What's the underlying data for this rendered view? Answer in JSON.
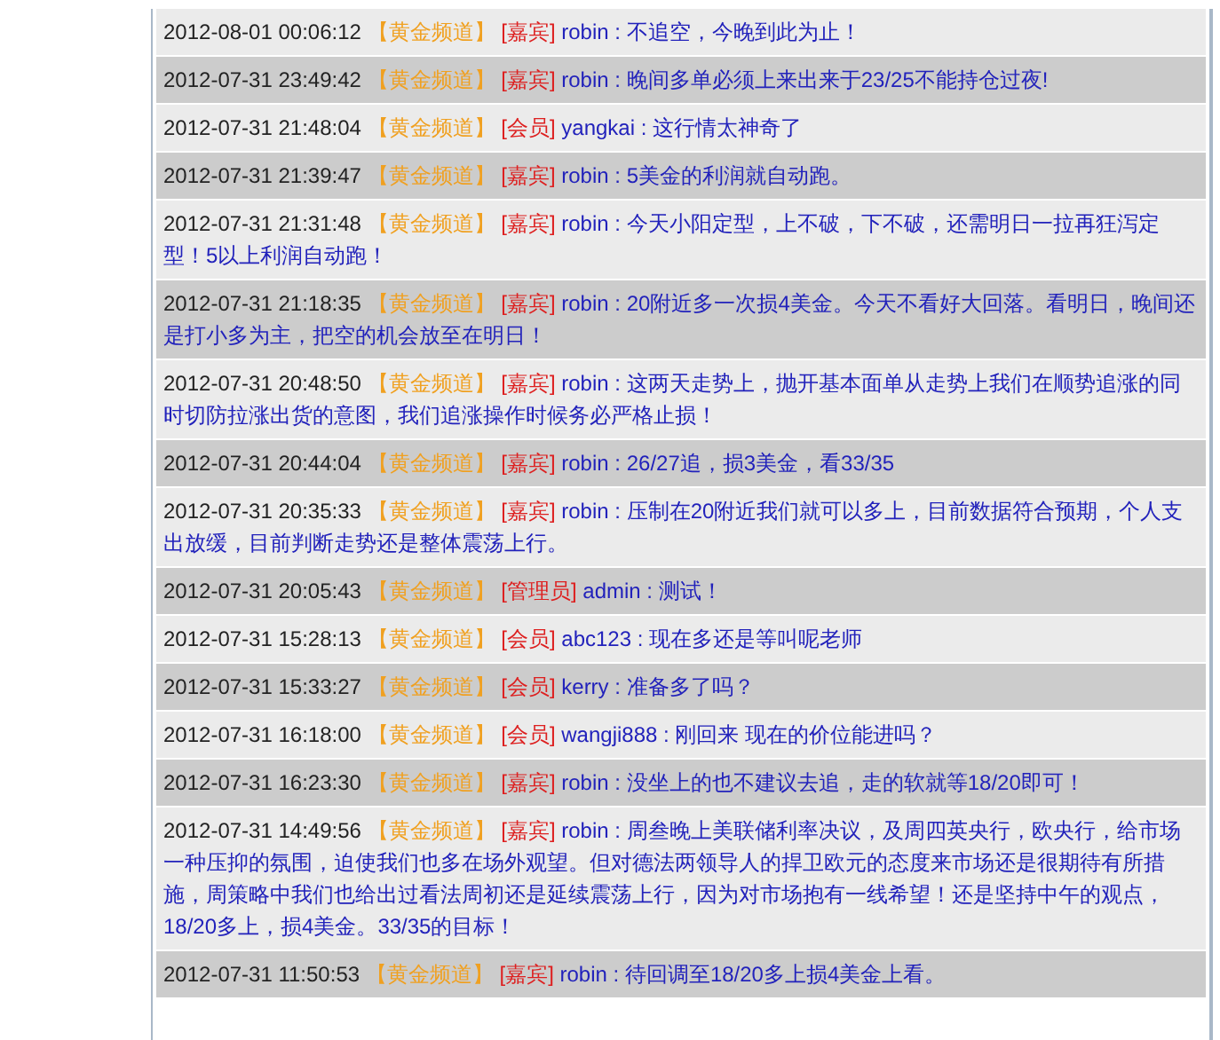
{
  "messages": [
    {
      "time": "2012-08-01 00:06:12",
      "channel": "【黄金频道】",
      "role": "[嘉宾]",
      "user": "robin",
      "separator": ":",
      "text": "不追空，今晚到此为止！"
    },
    {
      "time": "2012-07-31 23:49:42",
      "channel": "【黄金频道】",
      "role": "[嘉宾]",
      "user": "robin",
      "separator": ":",
      "text": "晚间多单必须上来出来于23/25不能持仓过夜!"
    },
    {
      "time": "2012-07-31 21:48:04",
      "channel": "【黄金频道】",
      "role": "[会员]",
      "user": "yangkai",
      "separator": ":",
      "text": "这行情太神奇了"
    },
    {
      "time": "2012-07-31 21:39:47",
      "channel": "【黄金频道】",
      "role": "[嘉宾]",
      "user": "robin",
      "separator": ":",
      "text": "5美金的利润就自动跑。"
    },
    {
      "time": "2012-07-31 21:31:48",
      "channel": "【黄金频道】",
      "role": "[嘉宾]",
      "user": "robin",
      "separator": ":",
      "text": "今天小阳定型，上不破，下不破，还需明日一拉再狂泻定型！5以上利润自动跑！"
    },
    {
      "time": "2012-07-31 21:18:35",
      "channel": "【黄金频道】",
      "role": "[嘉宾]",
      "user": "robin",
      "separator": ":",
      "text": "20附近多一次损4美金。今天不看好大回落。看明日，晚间还是打小多为主，把空的机会放至在明日！"
    },
    {
      "time": "2012-07-31 20:48:50",
      "channel": "【黄金频道】",
      "role": "[嘉宾]",
      "user": "robin",
      "separator": ":",
      "text": "这两天走势上，抛开基本面单从走势上我们在顺势追涨的同时切防拉涨出货的意图，我们追涨操作时候务必严格止损！"
    },
    {
      "time": "2012-07-31 20:44:04",
      "channel": "【黄金频道】",
      "role": "[嘉宾]",
      "user": "robin",
      "separator": ":",
      "text": "26/27追，损3美金，看33/35"
    },
    {
      "time": "2012-07-31 20:35:33",
      "channel": "【黄金频道】",
      "role": "[嘉宾]",
      "user": "robin",
      "separator": ":",
      "text": "压制在20附近我们就可以多上，目前数据符合预期，个人支出放缓，目前判断走势还是整体震荡上行。"
    },
    {
      "time": "2012-07-31 20:05:43",
      "channel": "【黄金频道】",
      "role": "[管理员]",
      "user": "admin",
      "separator": ":",
      "text": "测试！"
    },
    {
      "time": "2012-07-31 15:28:13",
      "channel": "【黄金频道】",
      "role": "[会员]",
      "user": "abc123",
      "separator": ":",
      "text": "现在多还是等叫呢老师"
    },
    {
      "time": "2012-07-31 15:33:27",
      "channel": "【黄金频道】",
      "role": "[会员]",
      "user": "kerry",
      "separator": ":",
      "text": "准备多了吗？"
    },
    {
      "time": "2012-07-31 16:18:00",
      "channel": "【黄金频道】",
      "role": "[会员]",
      "user": "wangji888",
      "separator": ":",
      "text": "刚回来 现在的价位能进吗？"
    },
    {
      "time": "2012-07-31 16:23:30",
      "channel": "【黄金频道】",
      "role": "[嘉宾]",
      "user": "robin",
      "separator": ":",
      "text": "没坐上的也不建议去追，走的软就等18/20即可！"
    },
    {
      "time": "2012-07-31 14:49:56",
      "channel": "【黄金频道】",
      "role": "[嘉宾]",
      "user": "robin",
      "separator": ":",
      "text": "周叁晚上美联储利率决议，及周四英央行，欧央行，给市场一种压抑的氛围，迫使我们也多在场外观望。但对德法两领导人的捍卫欧元的态度来市场还是很期待有所措施，周策略中我们也给出过看法周初还是延续震荡上行，因为对市场抱有一线希望！还是坚持中午的观点，18/20多上，损4美金。33/35的目标！"
    },
    {
      "time": "2012-07-31 11:50:53",
      "channel": "【黄金频道】",
      "role": "[嘉宾]",
      "user": "robin",
      "separator": ":",
      "text": "待回调至18/20多上损4美金上看。"
    }
  ]
}
